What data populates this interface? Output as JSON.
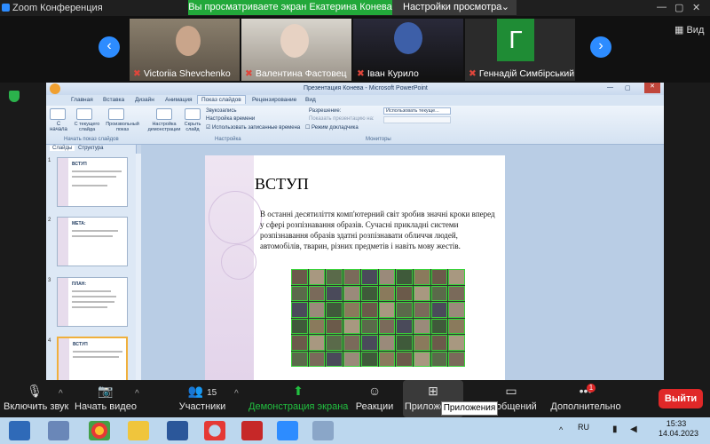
{
  "window": {
    "title": "Zoom Конференция",
    "share_banner": "Вы просматриваете экран Екатерина Конева",
    "view_options": "Настройки просмотра"
  },
  "gallery": {
    "view_label": "Вид",
    "participants": [
      {
        "name": "Victoriia Shevchenko"
      },
      {
        "name": "Валентина Фастовец"
      },
      {
        "name": "Іван Курило"
      },
      {
        "name": "Геннадій Симбірський",
        "initial": "Г"
      }
    ]
  },
  "powerpoint": {
    "title": "Презентация Конева - Microsoft PowerPoint",
    "tabs": [
      "Главная",
      "Вставка",
      "Дизайн",
      "Анимация",
      "Показ слайдов",
      "Рецензирование",
      "Вид"
    ],
    "ribbon": {
      "from_start": "С начала",
      "from_current": "С текущего слайда",
      "custom_show": "Произвольный показ",
      "group_start": "Начать показ слайдов",
      "setup": "Настройка демонстрации",
      "hide": "Скрыть слайд",
      "record": "Звукозапись",
      "rehearse": "Настройка времени",
      "use_timings": "Использовать записанные времена",
      "group_setup": "Настройка",
      "resolution_label": "Разрешение:",
      "resolution_value": "Использовать текуще...",
      "show_on": "Показать презентацию на:",
      "presenter_view": "Режим докладчика",
      "group_monitors": "Мониторы"
    },
    "panel_tabs": [
      "Слайды",
      "Структура"
    ],
    "thumbs": [
      {
        "num": "1",
        "title": "ВСТУП"
      },
      {
        "num": "2",
        "title": "МЕТА:"
      },
      {
        "num": "3",
        "title": "ПЛАН:"
      },
      {
        "num": "4",
        "title": "ВСТУП"
      }
    ],
    "slide": {
      "title": "ВСТУП",
      "body": "В останні десятиліття комп'ютерний світ зробив значні кроки вперед у сфері розпізнавання образів. Сучасні прикладні системи розпізнавання образів здатні розпізнавати обличчя людей, автомобілів, тварин, різних предметів і навіть мову жестів."
    }
  },
  "toolbar": {
    "mute": "Включить звук",
    "video": "Начать видео",
    "participants": "Участники",
    "participants_count": "15",
    "share": "Демонстрация экрана",
    "reactions": "Реакции",
    "apps": "Приложения",
    "apps_tooltip": "Приложения",
    "chat": "сообщений",
    "more": "Дополнительно",
    "more_badge": "1",
    "exit": "Выйти"
  },
  "taskbar": {
    "lang": "RU",
    "time": "15:33",
    "date": "14.04.2023"
  },
  "colors": {
    "accent": "#2d8cff",
    "share_green": "#22a83a",
    "exit_red": "#e02828"
  }
}
